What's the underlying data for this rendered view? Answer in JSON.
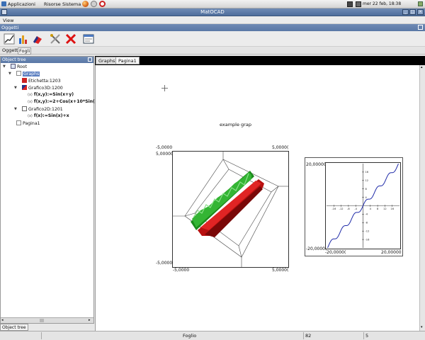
{
  "panel": {
    "menus": [
      "Applicazioni",
      "Risorse",
      "Sistema"
    ],
    "clock": "mer 22 feb, 18:38"
  },
  "window": {
    "title": "MatOCAD"
  },
  "menubar": {
    "view": "View"
  },
  "docks": {
    "oggetti": "Oggetti",
    "object_tree": "Object tree"
  },
  "toolbar": {
    "icons": [
      "line-chart-icon",
      "bar-chart-icon",
      "3d-chart-icon",
      "tools-icon",
      "delete-icon",
      "window-icon"
    ]
  },
  "tabs": {
    "oggetti": "Oggetti",
    "fogli": "Fogli"
  },
  "tree": {
    "root": "Root",
    "graphs": "Graphs",
    "etichetta": "Etichetta:1203",
    "grafico3d": "Grafico3D:1200",
    "f1": "f(x,y):=Sin(x+y)",
    "f2": "f(x,y):=2+Cos(x+10*Sin(y))",
    "grafico2d": "Grafico2D:1201",
    "f3": "f(x):=Sin(x)+x",
    "pagina1": "Pagina1"
  },
  "doc_tabs": [
    "Graphs",
    "Pagina1"
  ],
  "canvas": {
    "label": "example grap",
    "plot3d": {
      "top_left": "-5,0000",
      "top_right": "5,0000(",
      "left_top": "5,00000",
      "left_bottom": "-5,0000",
      "bottom_left": "-5,0000",
      "bottom_right": "5,0000("
    },
    "plot2d": {
      "y_top": "20,00000",
      "y_bottom": "-20,0000(",
      "x_left": "-20,0000(",
      "x_right": "20,00000"
    }
  },
  "chart_data": {
    "type": "line",
    "function": "f(x):=Sin(x)+x",
    "xlim": [
      -20,
      20
    ],
    "ylim": [
      -20,
      20
    ],
    "x_ticks": [
      -16,
      -12,
      -8,
      -4,
      4,
      8,
      12,
      16
    ],
    "y_ticks": [
      16,
      12,
      8,
      4,
      -4,
      -8,
      -12,
      -16
    ],
    "series": [
      {
        "color": "#1e2aa8",
        "x": [
          -20,
          -18,
          -16,
          -14,
          -12,
          -10,
          -8,
          -6,
          -4,
          -2,
          0,
          2,
          4,
          6,
          8,
          10,
          12,
          14,
          16,
          18,
          20
        ],
        "y": [
          -19.09,
          -18.75,
          -15.71,
          -13.01,
          -11.46,
          -9.46,
          -8.99,
          -5.72,
          -3.24,
          -2.91,
          0,
          2.91,
          3.24,
          5.72,
          8.99,
          9.46,
          11.46,
          13.01,
          15.71,
          18.75,
          19.09
        ]
      }
    ]
  },
  "status": {
    "left_tab": "Object tree",
    "foglio": "Foglio",
    "n1": "82",
    "n2": "5"
  }
}
